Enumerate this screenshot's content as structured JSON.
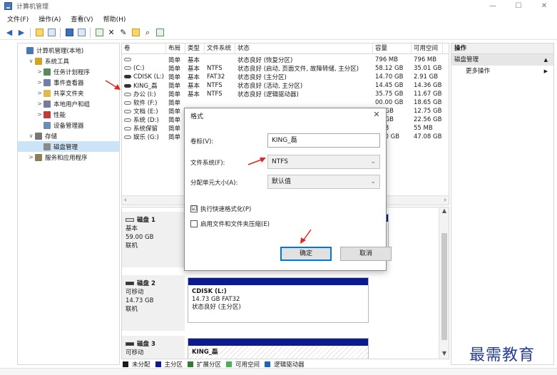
{
  "window": {
    "title": "计算机管理",
    "controls": {
      "minimize": "—",
      "maximize": "☐",
      "close": "✕"
    }
  },
  "menu": [
    "文件(F)",
    "操作(A)",
    "查看(V)",
    "帮助(H)"
  ],
  "toolbar": [
    "back-icon",
    "forward-icon",
    "up-folder-icon",
    "properties-icon",
    "help-icon",
    "view-icon",
    "check-icon",
    "delete-icon",
    "settings-icon",
    "open-icon",
    "search-icon",
    "shortcut-icon"
  ],
  "tree": [
    {
      "label": "计算机管理(本地)",
      "level": 0,
      "arrow": "",
      "icon_color": "#4a78b5"
    },
    {
      "label": "系统工具",
      "level": 1,
      "arrow": "∨",
      "icon_color": "#d5a21b"
    },
    {
      "label": "任务计划程序",
      "level": 2,
      "arrow": ">",
      "icon_color": "#5a8a5a"
    },
    {
      "label": "事件查看器",
      "level": 2,
      "arrow": ">",
      "icon_color": "#6d7fa8"
    },
    {
      "label": "共享文件夹",
      "level": 2,
      "arrow": ">",
      "icon_color": "#e1b84a"
    },
    {
      "label": "本地用户和组",
      "level": 2,
      "arrow": ">",
      "icon_color": "#7a7a9a"
    },
    {
      "label": "性能",
      "level": 2,
      "arrow": ">",
      "icon_color": "#c23b3b"
    },
    {
      "label": "设备管理器",
      "level": 2,
      "arrow": "",
      "icon_color": "#6b8eb8"
    },
    {
      "label": "存储",
      "level": 1,
      "arrow": "∨",
      "icon_color": "#777777"
    },
    {
      "label": "磁盘管理",
      "level": 2,
      "arrow": "",
      "icon_color": "#8a8a8a",
      "selected": true
    },
    {
      "label": "服务和应用程序",
      "level": 1,
      "arrow": ">",
      "icon_color": "#8c7f5a"
    }
  ],
  "volume_list": {
    "headers": [
      "卷",
      "布局",
      "类型",
      "文件系统",
      "状态",
      "容量",
      "可用空间"
    ],
    "rows": [
      {
        "vol": "",
        "layout": "简单",
        "type": "基本",
        "fs": "",
        "status": "状态良好 (恢复分区)",
        "cap": "796 MB",
        "free": "796 MB",
        "dark": false
      },
      {
        "vol": "(C:)",
        "layout": "简单",
        "type": "基本",
        "fs": "NTFS",
        "status": "状态良好 (启动, 页面文件, 故障转储, 主分区)",
        "cap": "58.12 GB",
        "free": "35.01 GB",
        "dark": false
      },
      {
        "vol": "CDISK (L:)",
        "layout": "简单",
        "type": "基本",
        "fs": "FAT32",
        "status": "状态良好 (主分区)",
        "cap": "14.70 GB",
        "free": "2.91 GB",
        "dark": true
      },
      {
        "vol": "KING_磊",
        "layout": "简单",
        "type": "基本",
        "fs": "NTFS",
        "status": "状态良好 (活动, 主分区)",
        "cap": "14.45 GB",
        "free": "14.36 GB",
        "dark": true
      },
      {
        "vol": "办公 (I:)",
        "layout": "简单",
        "type": "基本",
        "fs": "NTFS",
        "status": "状态良好 (逻辑驱动器)",
        "cap": "35.75 GB",
        "free": "11.67 GB",
        "dark": false
      },
      {
        "vol": "软件 (F:)",
        "layout": "简单",
        "type": "",
        "fs": "",
        "status": "",
        "cap": "00.00 GB",
        "free": "18.65 GB",
        "dark": false
      },
      {
        "vol": "文档 (E:)",
        "layout": "简单",
        "type": "",
        "fs": "",
        "status": "",
        "cap": "00 GB",
        "free": "12.75 GB",
        "dark": false
      },
      {
        "vol": "系统 (D:)",
        "layout": "简单",
        "type": "",
        "fs": "",
        "status": "",
        "cap": "00 GB",
        "free": "22.56 GB",
        "dark": false
      },
      {
        "vol": "系统保留",
        "layout": "简单",
        "type": "",
        "fs": "",
        "status": "",
        "cap": ") MB",
        "free": "55 MB",
        "dark": false
      },
      {
        "vol": "娱乐 (G:)",
        "layout": "简单",
        "type": "",
        "fs": "",
        "status": "",
        "cap": "0.00 GB",
        "free": "47.08 GB",
        "dark": false
      }
    ]
  },
  "disks": [
    {
      "name": "磁盘 1",
      "kind": "基本",
      "size": "59.00 GB",
      "status": "联机",
      "dark": false,
      "part_name": "",
      "part_size": "",
      "part_status": ""
    },
    {
      "name": "磁盘 2",
      "kind": "可移动",
      "size": "14.73 GB",
      "status": "联机",
      "dark": true,
      "part_name": "CDISK  (L:)",
      "part_size": "14.73 GB FAT32",
      "part_status": "状态良好 (主分区)"
    },
    {
      "name": "磁盘 3",
      "kind": "可移动",
      "size": "",
      "status": "",
      "dark": true,
      "part_name": "KING_磊",
      "part_size": "",
      "part_status": ""
    }
  ],
  "legend": [
    {
      "label": "未分配",
      "color": "#1a1a1a"
    },
    {
      "label": "主分区",
      "color": "#0b1a8c"
    },
    {
      "label": "扩展分区",
      "color": "#2e7d32"
    },
    {
      "label": "可用空间",
      "color": "#4caf50"
    },
    {
      "label": "逻辑驱动器",
      "color": "#1565c0"
    }
  ],
  "actions": {
    "header": "操作",
    "section": "磁盘管理",
    "more": "更多操作"
  },
  "dialog": {
    "title": "格式",
    "close": "✕",
    "volume_label_caption": "卷标(V):",
    "volume_label_value": "KING_磊",
    "fs_caption": "文件系统(F):",
    "fs_value": "NTFS",
    "alloc_caption": "分配单元大小(A):",
    "alloc_value": "默认值",
    "quick_format_label": "执行快速格式化(P)",
    "quick_format_checked": "☑",
    "compress_label": "启用文件和文件夹压缩(E)",
    "ok": "确定",
    "cancel": "取消",
    "disk1_partial": "区"
  },
  "watermark": "最需教育",
  "accent_colors": {
    "arrow": "#e0281f",
    "primary_button_border": "#0078d7",
    "partition_bar": "#0b1a8c"
  }
}
